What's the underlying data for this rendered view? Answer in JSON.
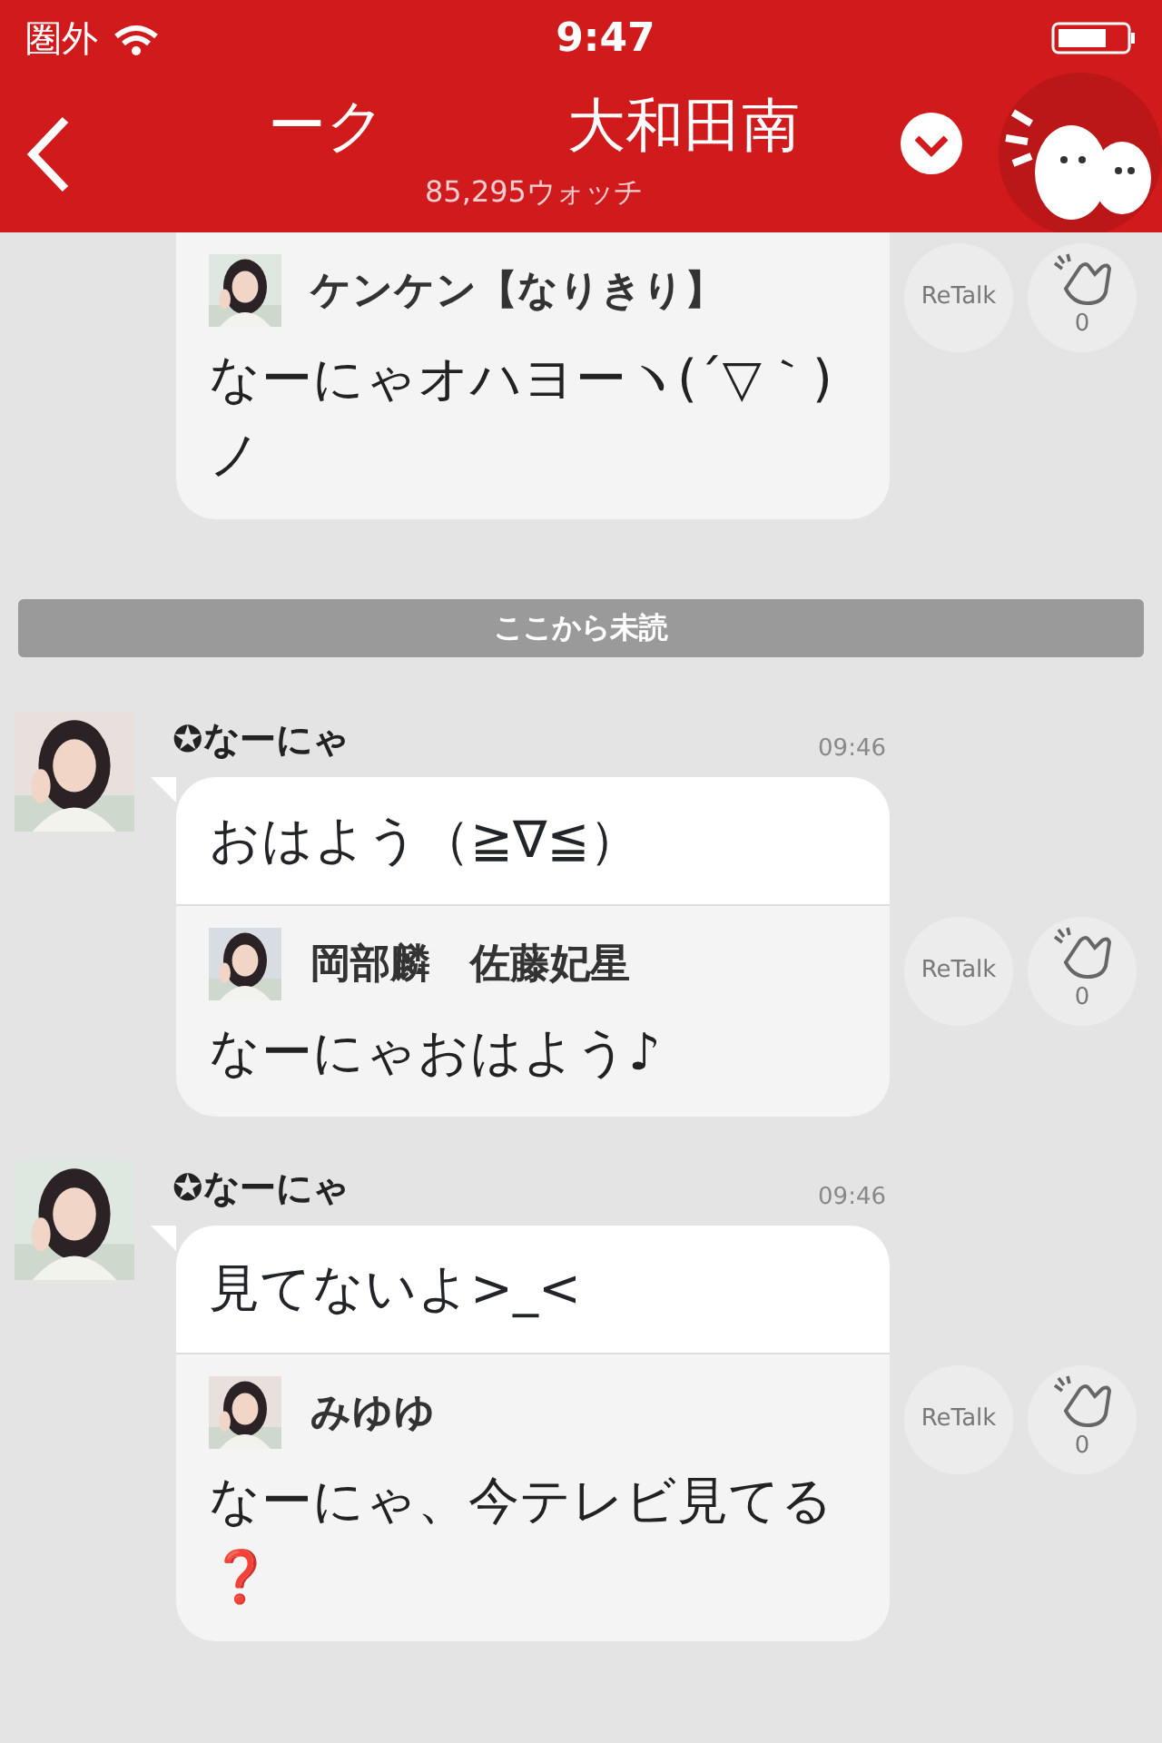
{
  "status_bar": {
    "carrier": "圏外",
    "time": "9:47"
  },
  "header": {
    "title_parts": [
      "ーク",
      "大和田南"
    ],
    "subtitle": "85,295ウォッチ"
  },
  "feed": [
    {
      "kind": "message",
      "reply": {
        "author": "ケンケン【なりきり】",
        "text": "なーにゃオハヨーヽ(´▽｀)ノ"
      },
      "retalk": "ReTalk",
      "claps": "0"
    },
    {
      "kind": "divider",
      "text": "ここから未読"
    },
    {
      "kind": "message",
      "author": "✪なーにゃ",
      "time": "09:46",
      "text": "おはよう（≧∇≦）",
      "reply": {
        "author": "岡部麟　佐藤妃星",
        "text": "なーにゃおはよう♪"
      },
      "retalk": "ReTalk",
      "claps": "0"
    },
    {
      "kind": "message",
      "author": "✪なーにゃ",
      "time": "09:46",
      "text": "見てないよ>_<",
      "reply": {
        "author": "みゆゆ",
        "text": "なーにゃ、今テレビ見てる❓"
      },
      "retalk": "ReTalk",
      "claps": "0"
    }
  ]
}
